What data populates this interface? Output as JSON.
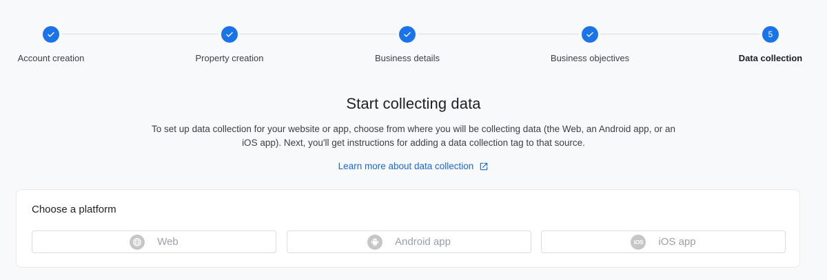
{
  "stepper": {
    "steps": [
      {
        "label": "Account creation",
        "state": "completed",
        "icon": "check-icon"
      },
      {
        "label": "Property creation",
        "state": "completed",
        "icon": "check-icon"
      },
      {
        "label": "Business details",
        "state": "completed",
        "icon": "check-icon"
      },
      {
        "label": "Business objectives",
        "state": "completed",
        "icon": "check-icon"
      },
      {
        "label": "Data collection",
        "state": "active",
        "number": "5"
      }
    ]
  },
  "intro": {
    "title": "Start collecting data",
    "description": "To set up data collection for your website or app, choose from where you will be collecting data (the Web, an Android app, or an iOS app). Next, you'll get instructions for adding a data collection tag to that source.",
    "learn_more": "Learn more about data collection",
    "learn_more_icon": "open-in-new-icon"
  },
  "platform_card": {
    "title": "Choose a platform",
    "options": [
      {
        "label": "Web",
        "icon": "globe-icon"
      },
      {
        "label": "Android app",
        "icon": "android-icon"
      },
      {
        "label": "iOS app",
        "icon": "ios-icon",
        "icon_text": "iOS"
      }
    ]
  },
  "colors": {
    "accent": "#1a73e8",
    "link": "#1967d2",
    "background": "#f8f9fb",
    "disabled_text": "#9aa0a6"
  }
}
